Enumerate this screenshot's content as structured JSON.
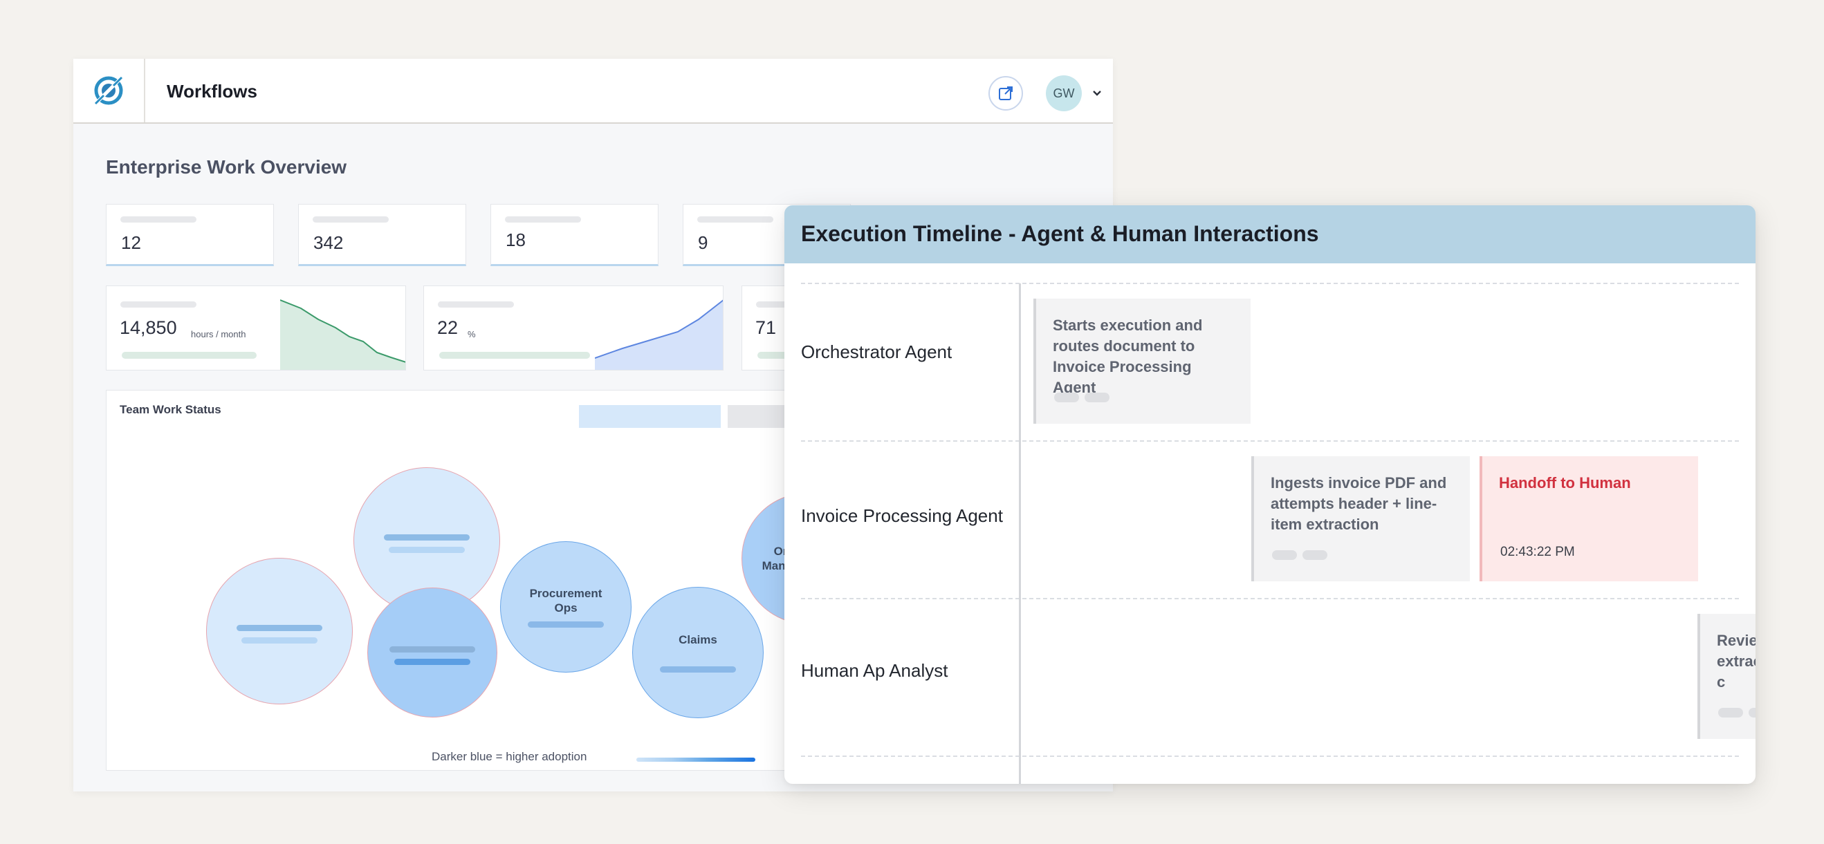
{
  "app": {
    "title": "Workflows",
    "avatar_initials": "GW",
    "logo_icon": "eye-orbit-logo",
    "external_icon": "open-external-icon",
    "chevron_icon": "chevron-down-icon"
  },
  "dashboard": {
    "title": "Enterprise Work Overview",
    "kpis": [
      {
        "value": "12"
      },
      {
        "value": "342"
      },
      {
        "value": "18"
      },
      {
        "value": "9"
      }
    ],
    "metrics": [
      {
        "value": "14,850",
        "unit": "hours / month",
        "trend_color": "#3b9a6a"
      },
      {
        "value": "22",
        "unit": "%",
        "trend_color": "#5d86e0"
      },
      {
        "value": "71",
        "unit": "%"
      }
    ],
    "team_status": {
      "title": "Team Work Status",
      "bubbles": [
        {
          "label": ""
        },
        {
          "label": ""
        },
        {
          "label": ""
        },
        {
          "label": "Procurement Ops"
        },
        {
          "label": "Claims"
        },
        {
          "label": "Or… Manag…"
        }
      ],
      "legend": "Darker blue = higher adoption"
    }
  },
  "timeline": {
    "title": "Execution Timeline - Agent & Human Interactions",
    "rows": [
      {
        "label": "Orchestrator Agent"
      },
      {
        "label": "Invoice Processing Agent"
      },
      {
        "label": "Human Ap Analyst"
      }
    ],
    "events": [
      {
        "text": "Starts execution and routes document to Invoice Processing Agent"
      },
      {
        "text": "Ingests invoice PDF and attempts header + line-item extraction"
      },
      {
        "text": "Handoff to Human",
        "time": "02:43:22 PM"
      },
      {
        "text": "Review extrac tax, c"
      }
    ]
  }
}
